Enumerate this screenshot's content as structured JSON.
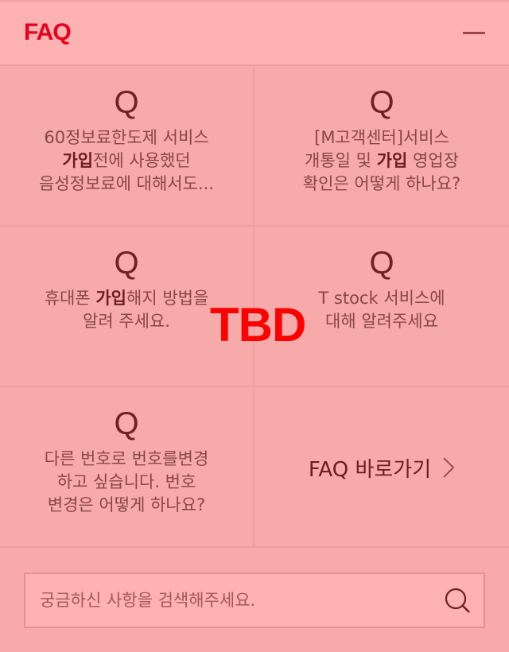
{
  "header": {
    "title": "FAQ"
  },
  "questions": [
    {
      "q": "Q",
      "lines": [
        [
          "60정보료한도제 서비스",
          "",
          ""
        ],
        [
          "",
          "가입",
          "전에 사용했던"
        ],
        [
          "음성정보료에 대해서도...",
          "",
          ""
        ]
      ]
    },
    {
      "q": "Q",
      "lines": [
        [
          "[M고객센터]서비스",
          "",
          ""
        ],
        [
          "개통일 및 ",
          "가입",
          " 영업장"
        ],
        [
          "확인은 어떻게 하나요?",
          "",
          ""
        ]
      ]
    },
    {
      "q": "Q",
      "lines": [
        [
          "휴대폰 ",
          "가입",
          "해지 방법을"
        ],
        [
          "알려 주세요.",
          "",
          ""
        ]
      ]
    },
    {
      "q": "Q",
      "lines": [
        [
          "T stock 서비스에",
          "",
          ""
        ],
        [
          "대해 알려주세요",
          "",
          ""
        ]
      ]
    },
    {
      "q": "Q",
      "lines": [
        [
          "다른 번호로 번호를변경",
          "",
          ""
        ],
        [
          "하고 싶습니다. 번호",
          "",
          ""
        ],
        [
          "변경은 어떻게 하나요?",
          "",
          ""
        ]
      ]
    }
  ],
  "shortcut": {
    "label": "FAQ 바로가기"
  },
  "overlay": {
    "label": "TBD"
  },
  "search": {
    "placeholder": "궁금하신 사항을 검색해주세요.",
    "value": ""
  }
}
